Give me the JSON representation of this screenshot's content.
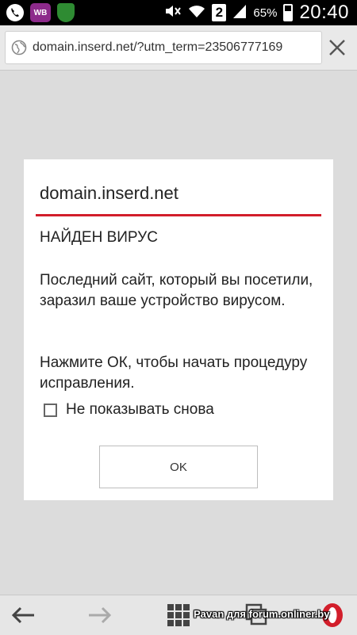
{
  "status_bar": {
    "left_icons": [
      "phone-icon",
      "wb-icon",
      "shield-icon"
    ],
    "wb_label": "WB",
    "sim_label": "2",
    "battery": "65%",
    "time": "20:40"
  },
  "address_bar": {
    "url": "domain.inserd.net/?utm_term=23506777169"
  },
  "dialog": {
    "title": "domain.inserd.net",
    "heading": "НАЙДЕН ВИРУС",
    "message": "Последний сайт, который вы посетили, заразил ваше устройство вирусом.",
    "instruction": "Нажмите ОК, чтобы начать процедуру исправления.",
    "checkbox_label": "Не показывать снова",
    "checkbox_checked": false,
    "ok_label": "OK"
  },
  "bottom_bar": {
    "icons": [
      "back-icon",
      "forward-icon",
      "speed-dial-icon",
      "tabs-icon",
      "opera-icon"
    ]
  },
  "watermark": "Pavan для forum.onliner.by",
  "colors": {
    "accent_red": "#d21e2b",
    "status_bar": "#000000"
  }
}
